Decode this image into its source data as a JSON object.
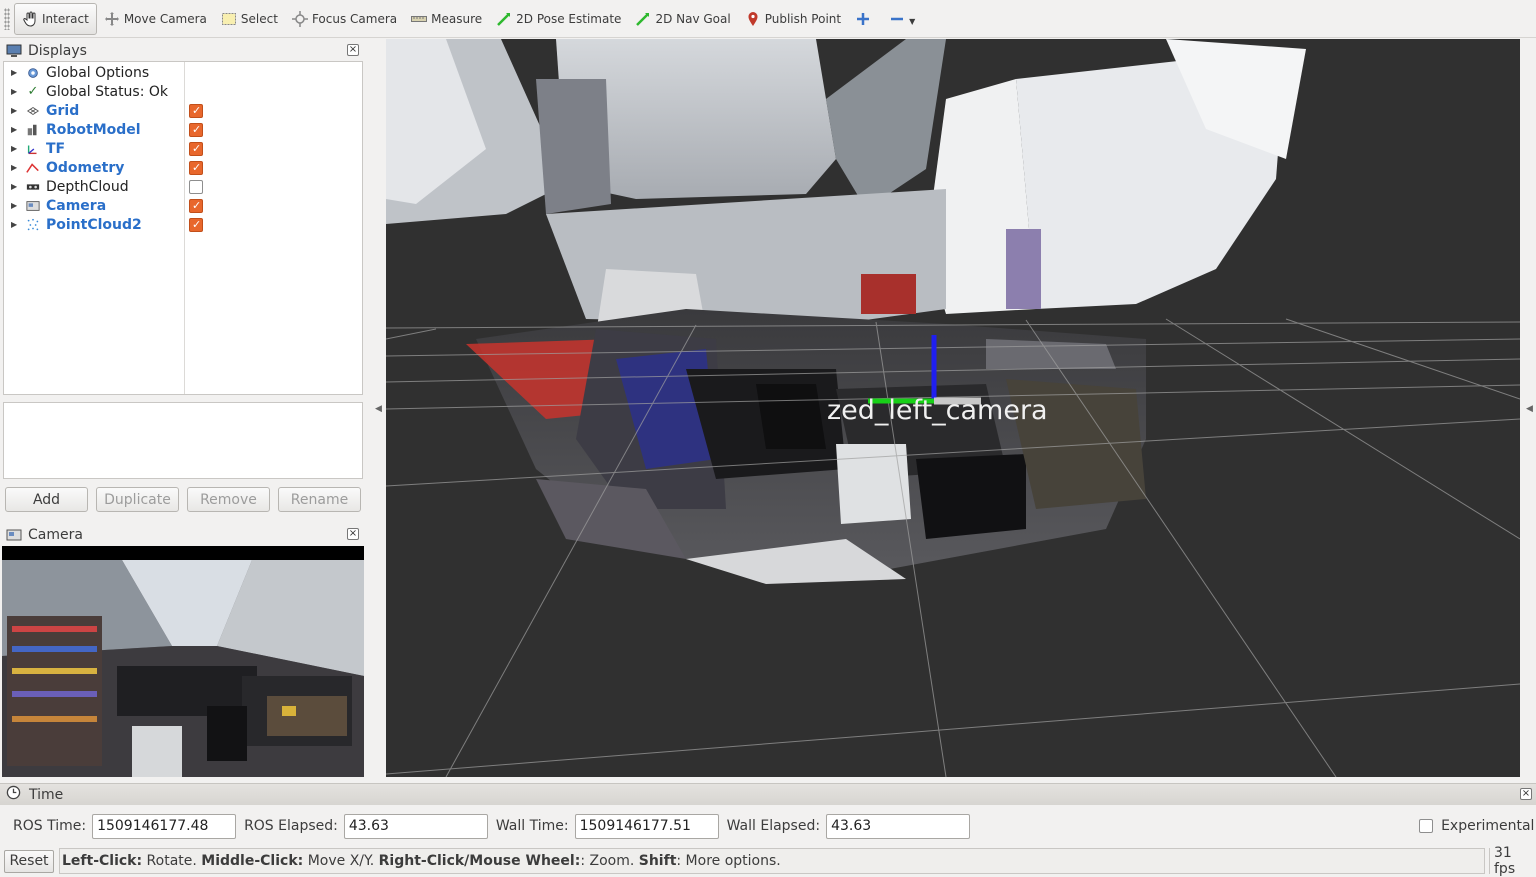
{
  "toolbar": {
    "tools": [
      {
        "label": "Interact",
        "icon": "hand-pointer-icon"
      },
      {
        "label": "Move Camera",
        "icon": "move-arrows-icon"
      },
      {
        "label": "Select",
        "icon": "select-box-icon"
      },
      {
        "label": "Focus Camera",
        "icon": "focus-crosshair-icon"
      },
      {
        "label": "Measure",
        "icon": "ruler-icon"
      },
      {
        "label": "2D Pose Estimate",
        "icon": "green-arrow-icon"
      },
      {
        "label": "2D Nav Goal",
        "icon": "green-arrow-icon"
      },
      {
        "label": "Publish Point",
        "icon": "map-pin-icon"
      }
    ]
  },
  "displays": {
    "title": "Displays",
    "items": [
      {
        "label": "Global Options",
        "icon": "gear-icon",
        "checked": null,
        "highlight": false
      },
      {
        "label": "Global Status: Ok",
        "icon": "checkmark-icon",
        "checked": null,
        "highlight": false
      },
      {
        "label": "Grid",
        "icon": "grid-icon",
        "checked": true,
        "highlight": true
      },
      {
        "label": "RobotModel",
        "icon": "robot-icon",
        "checked": true,
        "highlight": true
      },
      {
        "label": "TF",
        "icon": "axes-icon",
        "checked": true,
        "highlight": true
      },
      {
        "label": "Odometry",
        "icon": "odometry-icon",
        "checked": true,
        "highlight": true
      },
      {
        "label": "DepthCloud",
        "icon": "depthcloud-icon",
        "checked": false,
        "highlight": false
      },
      {
        "label": "Camera",
        "icon": "camera-icon",
        "checked": true,
        "highlight": true
      },
      {
        "label": "PointCloud2",
        "icon": "pointcloud-icon",
        "checked": true,
        "highlight": true
      }
    ],
    "buttons": {
      "add": "Add",
      "duplicate": "Duplicate",
      "remove": "Remove",
      "rename": "Rename"
    }
  },
  "camera_panel": {
    "title": "Camera"
  },
  "viewport": {
    "frame_label": "zed_left_camera"
  },
  "time": {
    "title": "Time",
    "ros_time_label": "ROS Time:",
    "ros_time": "1509146177.48",
    "ros_elapsed_label": "ROS Elapsed:",
    "ros_elapsed": "43.63",
    "wall_time_label": "Wall Time:",
    "wall_time": "1509146177.51",
    "wall_elapsed_label": "Wall Elapsed:",
    "wall_elapsed": "43.63",
    "experimental_label": "Experimental",
    "experimental_checked": false
  },
  "status": {
    "reset_label": "Reset",
    "hint_1_key": "Left-Click:",
    "hint_1_val": " Rotate. ",
    "hint_2_key": "Middle-Click:",
    "hint_2_val": " Move X/Y. ",
    "hint_3_key": "Right-Click/Mouse Wheel:",
    "hint_3_val": ": Zoom. ",
    "hint_4_key": "Shift",
    "hint_4_val": ": More options.",
    "fps": "31 fps"
  }
}
